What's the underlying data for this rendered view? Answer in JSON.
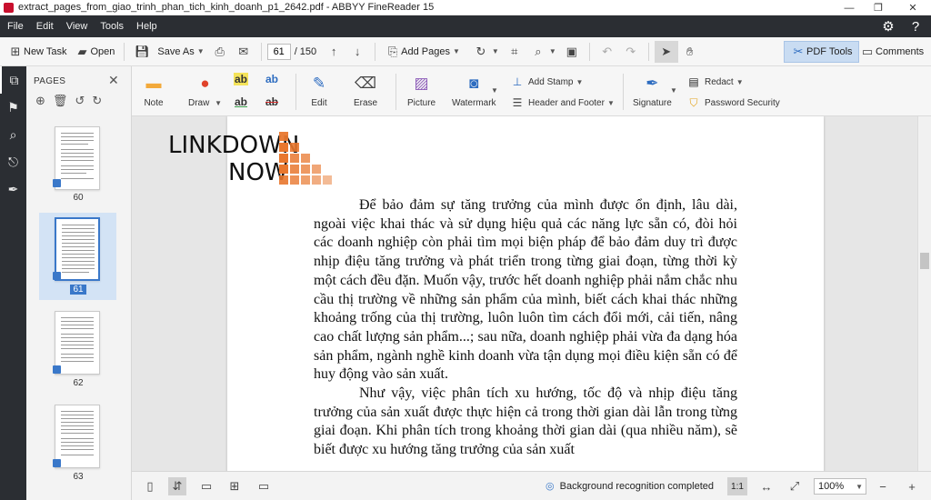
{
  "window": {
    "title": "extract_pages_from_giao_trinh_phan_tich_kinh_doanh_p1_2642.pdf - ABBYY FineReader 15"
  },
  "menu": [
    "File",
    "Edit",
    "View",
    "Tools",
    "Help"
  ],
  "toolbar": {
    "new_task": "New Task",
    "open": "Open",
    "save_as": "Save As",
    "page_current": "61",
    "page_total": "/ 150",
    "add_pages": "Add Pages",
    "pdf_tools": "PDF Tools",
    "comments": "Comments"
  },
  "pages_panel": {
    "title": "PAGES",
    "thumbnails": [
      {
        "label": "60"
      },
      {
        "label": "61"
      },
      {
        "label": "62"
      },
      {
        "label": "63"
      }
    ]
  },
  "ribbon": {
    "note": "Note",
    "draw": "Draw",
    "edit": "Edit",
    "erase": "Erase",
    "picture": "Picture",
    "watermark": "Watermark",
    "add_stamp": "Add Stamp",
    "header_footer": "Header and Footer",
    "signature": "Signature",
    "redact": "Redact",
    "password_security": "Password Security",
    "highlight_glyph": "ab"
  },
  "document": {
    "watermark_line1": "LINKDOWN",
    "watermark_line2": "NOW",
    "paragraph1": "Để bảo đảm sự tăng trưởng của mình được ổn định, lâu dài, ngoài việc khai thác và sử dụng hiệu quả các năng lực sẵn có, đòi hỏi các doanh nghiệp còn phải tìm mọi biện pháp để bảo đảm duy trì được nhịp điệu tăng trưởng và phát triển trong từng giai đoạn, từng thời kỳ một cách đều đặn. Muốn vậy, trước hết doanh nghiệp phải nắm chắc nhu cầu thị trường về những sản phẩm của mình, biết cách khai thác những khoảng trống của thị trường, luôn luôn tìm cách đổi mới, cải tiến, nâng cao chất lượng sản phẩm...; sau nữa, doanh nghiệp phải vừa đa dạng hóa sản phẩm, ngành nghề kinh doanh vừa tận dụng mọi điều kiện sẵn có để huy động vào sản xuất.",
    "paragraph2": "Như vậy, việc phân tích xu hướng, tốc độ và nhịp điệu tăng trưởng của sản xuất được thực hiện cả trong thời gian dài lẫn trong từng giai đoạn. Khi phân tích trong khoảng thời gian dài (qua nhiều năm), sẽ biết được xu hướng tăng trưởng của sản xuất"
  },
  "statusbar": {
    "background_status": "Background recognition completed",
    "fit_label": "1:1",
    "zoom": "100%"
  },
  "colors": {
    "dark_bar": "#2b2e33",
    "accent_blue": "#3a78c9",
    "watermark_orange": "#e8772e"
  }
}
